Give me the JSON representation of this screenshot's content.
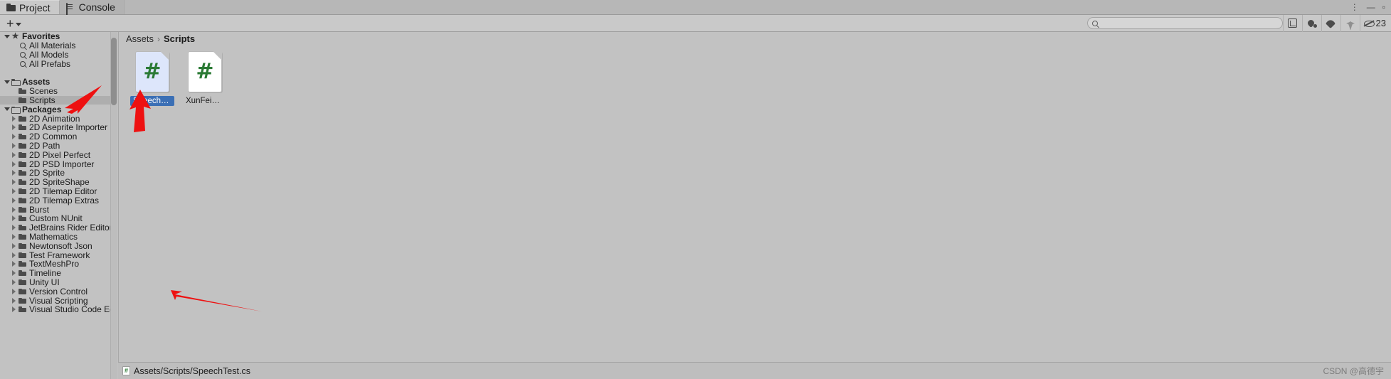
{
  "window": {
    "tabs": [
      {
        "label": "Project",
        "icon": "folder-icon",
        "active": true
      },
      {
        "label": "Console",
        "icon": "console-icon",
        "active": false
      }
    ],
    "menu_dots": "⋮",
    "minimize": "—",
    "maximize": "▫"
  },
  "toolbar": {
    "add_label": "+",
    "search_placeholder": "",
    "search_value": "",
    "icons": [
      {
        "name": "search-expand-icon"
      },
      {
        "name": "filter-type-icon"
      },
      {
        "name": "filter-label-icon"
      },
      {
        "name": "filter-favorite-icon"
      }
    ],
    "hidden_items_count": "23",
    "hidden_items_icon": "eye-slash-icon"
  },
  "tree": {
    "items": [
      {
        "label": "Favorites",
        "icon": "star-icon",
        "twisty": "open",
        "depth": 0,
        "bold": true,
        "selected": false
      },
      {
        "label": "All Materials",
        "icon": "search-icon",
        "twisty": "none",
        "depth": 1,
        "bold": false,
        "selected": false
      },
      {
        "label": "All Models",
        "icon": "search-icon",
        "twisty": "none",
        "depth": 1,
        "bold": false,
        "selected": false
      },
      {
        "label": "All Prefabs",
        "icon": "search-icon",
        "twisty": "none",
        "depth": 1,
        "bold": false,
        "selected": false
      },
      {
        "label": "",
        "icon": "none",
        "twisty": "none",
        "depth": 0,
        "bold": false,
        "selected": false
      },
      {
        "label": "Assets",
        "icon": "folder-open-icon",
        "twisty": "open",
        "depth": 0,
        "bold": true,
        "selected": false
      },
      {
        "label": "Scenes",
        "icon": "folder-icon",
        "twisty": "none",
        "depth": 1,
        "bold": false,
        "selected": false
      },
      {
        "label": "Scripts",
        "icon": "folder-icon",
        "twisty": "none",
        "depth": 1,
        "bold": false,
        "selected": true
      },
      {
        "label": "Packages",
        "icon": "folder-open-icon",
        "twisty": "open",
        "depth": 0,
        "bold": true,
        "selected": false
      },
      {
        "label": "2D Animation",
        "icon": "folder-icon",
        "twisty": "closed",
        "depth": 1,
        "bold": false,
        "selected": false
      },
      {
        "label": "2D Aseprite Importer",
        "icon": "folder-icon",
        "twisty": "closed",
        "depth": 1,
        "bold": false,
        "selected": false
      },
      {
        "label": "2D Common",
        "icon": "folder-icon",
        "twisty": "closed",
        "depth": 1,
        "bold": false,
        "selected": false
      },
      {
        "label": "2D Path",
        "icon": "folder-icon",
        "twisty": "closed",
        "depth": 1,
        "bold": false,
        "selected": false
      },
      {
        "label": "2D Pixel Perfect",
        "icon": "folder-icon",
        "twisty": "closed",
        "depth": 1,
        "bold": false,
        "selected": false
      },
      {
        "label": "2D PSD Importer",
        "icon": "folder-icon",
        "twisty": "closed",
        "depth": 1,
        "bold": false,
        "selected": false
      },
      {
        "label": "2D Sprite",
        "icon": "folder-icon",
        "twisty": "closed",
        "depth": 1,
        "bold": false,
        "selected": false
      },
      {
        "label": "2D SpriteShape",
        "icon": "folder-icon",
        "twisty": "closed",
        "depth": 1,
        "bold": false,
        "selected": false
      },
      {
        "label": "2D Tilemap Editor",
        "icon": "folder-icon",
        "twisty": "closed",
        "depth": 1,
        "bold": false,
        "selected": false
      },
      {
        "label": "2D Tilemap Extras",
        "icon": "folder-icon",
        "twisty": "closed",
        "depth": 1,
        "bold": false,
        "selected": false
      },
      {
        "label": "Burst",
        "icon": "folder-icon",
        "twisty": "closed",
        "depth": 1,
        "bold": false,
        "selected": false
      },
      {
        "label": "Custom NUnit",
        "icon": "folder-icon",
        "twisty": "closed",
        "depth": 1,
        "bold": false,
        "selected": false
      },
      {
        "label": "JetBrains Rider Editor",
        "icon": "folder-icon",
        "twisty": "closed",
        "depth": 1,
        "bold": false,
        "selected": false
      },
      {
        "label": "Mathematics",
        "icon": "folder-icon",
        "twisty": "closed",
        "depth": 1,
        "bold": false,
        "selected": false
      },
      {
        "label": "Newtonsoft Json",
        "icon": "folder-icon",
        "twisty": "closed",
        "depth": 1,
        "bold": false,
        "selected": false
      },
      {
        "label": "Test Framework",
        "icon": "folder-icon",
        "twisty": "closed",
        "depth": 1,
        "bold": false,
        "selected": false
      },
      {
        "label": "TextMeshPro",
        "icon": "folder-icon",
        "twisty": "closed",
        "depth": 1,
        "bold": false,
        "selected": false
      },
      {
        "label": "Timeline",
        "icon": "folder-icon",
        "twisty": "closed",
        "depth": 1,
        "bold": false,
        "selected": false
      },
      {
        "label": "Unity UI",
        "icon": "folder-icon",
        "twisty": "closed",
        "depth": 1,
        "bold": false,
        "selected": false
      },
      {
        "label": "Version Control",
        "icon": "folder-icon",
        "twisty": "closed",
        "depth": 1,
        "bold": false,
        "selected": false
      },
      {
        "label": "Visual Scripting",
        "icon": "folder-icon",
        "twisty": "closed",
        "depth": 1,
        "bold": false,
        "selected": false
      },
      {
        "label": "Visual Studio Code Editor",
        "icon": "folder-icon",
        "twisty": "closed",
        "depth": 1,
        "bold": false,
        "selected": false
      }
    ]
  },
  "breadcrumb": {
    "root": "Assets",
    "separator": "›",
    "current": "Scripts"
  },
  "files": [
    {
      "name": "SpeechTest",
      "glyph": "#",
      "type": "csharp-script",
      "selected": true
    },
    {
      "name": "XunFeiMa...",
      "glyph": "#",
      "type": "csharp-script",
      "selected": false
    }
  ],
  "status": {
    "path": "Assets/Scripts/SpeechTest.cs",
    "icon": "csharp-file-icon"
  },
  "watermark": "CSDN @高德宇",
  "colors": {
    "selection_blue": "#3b6fb5",
    "csharp_green": "#2a7a34",
    "annotation_red": "#ee1111",
    "panel_bg": "#c2c2c2",
    "toolbar_bg": "#c9c9c9",
    "row_selected": "#aeaeae"
  },
  "annotations": [
    {
      "name": "arrow-to-scripts-folder",
      "color": "#ee1111"
    },
    {
      "name": "arrow-to-speechtest-tile",
      "color": "#ee1111"
    },
    {
      "name": "arrow-to-status-path",
      "color": "#ee1111"
    }
  ]
}
